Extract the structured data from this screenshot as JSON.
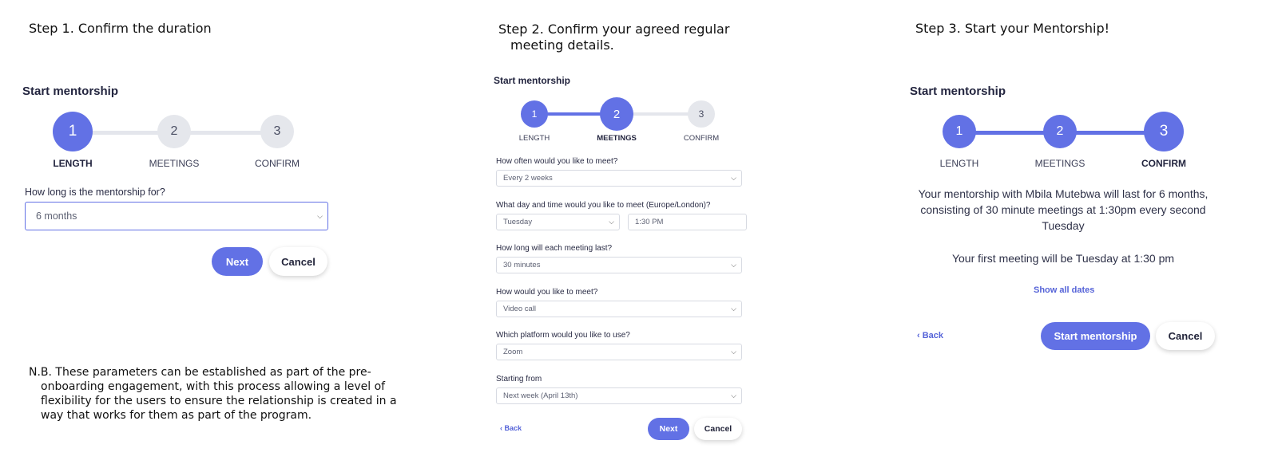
{
  "captions": {
    "step1": "Step 1. Confirm the duration",
    "step2": "Step 2. Confirm your agreed regular meeting details.",
    "step3": "Step 3. Start your Mentorship!",
    "note": "N.B. These parameters can be established as part of the pre-onboarding engagement, with this process allowing a level of flexibility for the users to ensure the relationship is created in a way that works for them as part of the program."
  },
  "colors": {
    "accent": "#6271e5",
    "inactive_step": "#e5e7ec"
  },
  "steps": [
    "1",
    "2",
    "3"
  ],
  "step_labels": [
    "LENGTH",
    "MEETINGS",
    "CONFIRM"
  ],
  "panel1": {
    "title": "Start mentorship",
    "current_step": 1,
    "duration_label": "How long is the mentorship for?",
    "duration_value": "6 months",
    "next": "Next",
    "cancel": "Cancel"
  },
  "panel2": {
    "title": "Start mentorship",
    "current_step": 2,
    "frequency_label": "How often would you like to meet?",
    "frequency_value": "Every 2 weeks",
    "daytime_label": "What day and time would you like to meet (Europe/London)?",
    "day_value": "Tuesday",
    "time_value": "1:30 PM",
    "length_label": "How long will each meeting last?",
    "length_value": "30 minutes",
    "method_label": "How would you like to meet?",
    "method_value": "Video call",
    "platform_label": "Which platform would you like to use?",
    "platform_value": "Zoom",
    "start_label": "Starting from",
    "start_value": "Next week (April 13th)",
    "back": "Back",
    "next": "Next",
    "cancel": "Cancel"
  },
  "panel3": {
    "title": "Start mentorship",
    "current_step": 3,
    "summary": "Your mentorship with Mbila Mutebwa will last for 6 months, consisting of 30 minute meetings at 1:30pm every second Tuesday",
    "first_meeting": "Your first meeting will be Tuesday at 1:30 pm",
    "show_dates": "Show all dates",
    "back": "Back",
    "start": "Start mentorship",
    "cancel": "Cancel"
  }
}
